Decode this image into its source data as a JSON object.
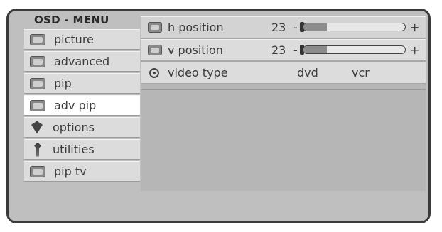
{
  "header": {
    "title": "OSD - MENU"
  },
  "menu": {
    "items": [
      {
        "label": "picture",
        "icon": "picture-icon"
      },
      {
        "label": "advanced",
        "icon": "advanced-icon"
      },
      {
        "label": "pip",
        "icon": "pip-icon"
      },
      {
        "label": "adv pip",
        "icon": "adv-pip-icon",
        "selected": true
      },
      {
        "label": "options",
        "icon": "options-icon"
      },
      {
        "label": "utilities",
        "icon": "utilities-icon"
      },
      {
        "label": "pip tv",
        "icon": "pip-tv-icon"
      }
    ]
  },
  "settings": {
    "h_position": {
      "label": "h position",
      "value": "23",
      "minus": "-",
      "plus": "+",
      "level": 0.23
    },
    "v_position": {
      "label": "v position",
      "value": "23",
      "minus": "-",
      "plus": "+",
      "level": 0.23
    },
    "video_type": {
      "label": "video type",
      "options": [
        "dvd",
        "vcr"
      ]
    }
  },
  "colors": {
    "frame": "#bfbfbf",
    "item": "#dcdcdc",
    "selected": "#ffffff",
    "border": "#3a3a3a"
  }
}
